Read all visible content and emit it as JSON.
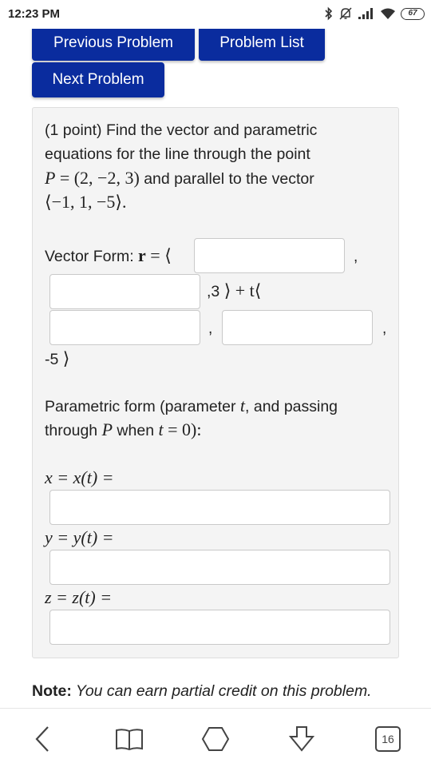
{
  "status_bar": {
    "time": "12:23 PM",
    "battery": "67",
    "icons": [
      "bluetooth-icon",
      "muted-bell-icon",
      "signal-icon",
      "wifi-icon",
      "battery-icon"
    ]
  },
  "buttons": {
    "previous": "Previous Problem",
    "list": "Problem List",
    "next": "Next Problem"
  },
  "problem": {
    "line1": "(1 point) Find the vector and parametric",
    "line2": "equations for the line through the point",
    "point_label": "P",
    "equals": "=",
    "point_value": "(2, −2, 3)",
    "line3_rest": " and parallel to the vector",
    "vector": "⟨−1, 1, −5⟩.",
    "vector_form_label": "Vector Form: ",
    "r_symbol": "r",
    "r_equals": " = ⟨",
    "comma": ",",
    "const_z": ",3",
    "plus_t": "⟩ + t⟨",
    "const_dz": "-5",
    "close_angle": "⟩",
    "param_line1_a": "Parametric form (parameter ",
    "param_t": "t",
    "param_line1_b": ", and passing",
    "param_line2_a": "through ",
    "param_P": "P",
    "param_line2_b": " when ",
    "param_t2": "t",
    "param_line2_c": " = 0):",
    "x_eq": "x = x(t) =",
    "y_eq": "y = y(t) =",
    "z_eq": "z = z(t) =",
    "inputs": {
      "vx0": "",
      "vy0": "",
      "vdx": "",
      "vdy": "",
      "x_t": "",
      "y_t": "",
      "z_t": ""
    }
  },
  "note": {
    "label": "Note:",
    "text": " You can earn partial credit on this problem."
  },
  "nav": {
    "tab_count": "16",
    "icons": [
      "back-icon",
      "bookmarks-icon",
      "home-icon",
      "download-icon",
      "tabs-icon"
    ]
  }
}
